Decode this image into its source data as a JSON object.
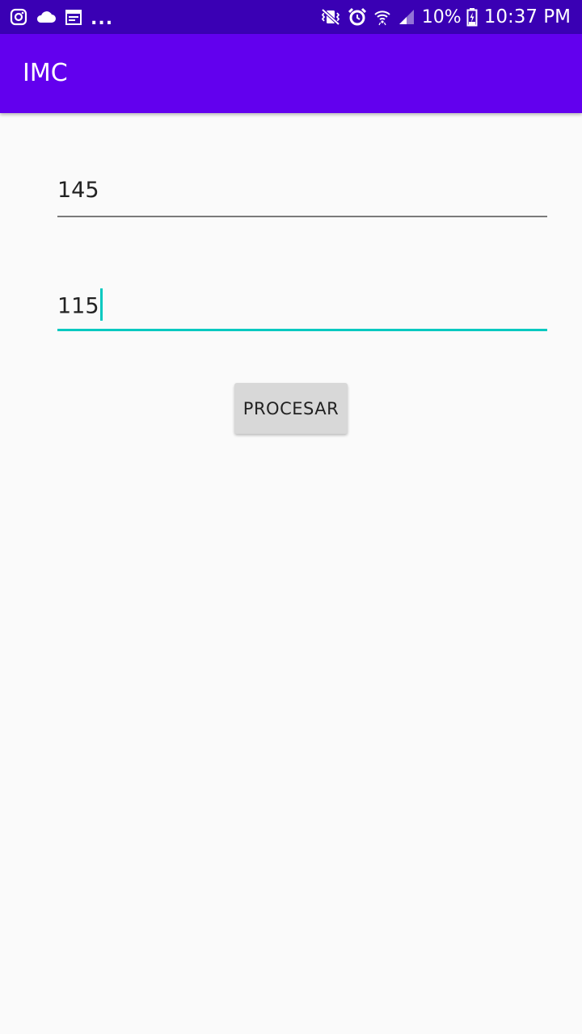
{
  "status_bar": {
    "left_icons": [
      "instagram-icon",
      "cloud-icon",
      "calendar-icon"
    ],
    "overflow": "...",
    "right_icons": [
      "vibrate-mute-icon",
      "alarm-icon",
      "wifi-icon",
      "signal-icon"
    ],
    "battery_percent": "10%",
    "time": "10:37 PM"
  },
  "app_bar": {
    "title": "IMC"
  },
  "form": {
    "field1_value": "145",
    "field2_value": "115",
    "process_button": "PROCESAR"
  },
  "colors": {
    "status_bar": "#3a00b4",
    "app_bar": "#6200ee",
    "accent": "#03c9c0",
    "background": "#fafafa",
    "button": "#d8d8d8"
  }
}
